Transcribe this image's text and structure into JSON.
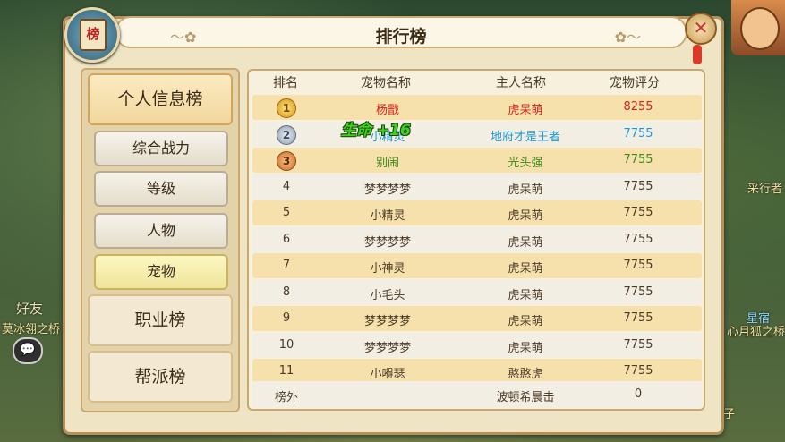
{
  "window": {
    "title": "排行榜",
    "badge_glyph": "榜",
    "close_glyph": "✕"
  },
  "background": {
    "left_name": "好友",
    "left_sub": "莫冰翎之桥",
    "right_name_1": "采行者",
    "right_name_2": "星宿",
    "right_name_3": "心月狐之桥",
    "right_name_4": "子",
    "chat_glyph": "💬"
  },
  "tabs": {
    "personal": "个人信息榜",
    "sub": [
      "综合战力",
      "等级",
      "人物",
      "宠物"
    ],
    "profession": "职业榜",
    "guild": "帮派榜"
  },
  "table": {
    "headers": [
      "排名",
      "宠物名称",
      "主人名称",
      "宠物评分"
    ],
    "rows": [
      {
        "rank": "1",
        "pet": "杨戬",
        "owner": "虎呆萌",
        "score": "8255"
      },
      {
        "rank": "2",
        "pet": "小精灵",
        "owner": "地府才是王者",
        "score": "7755"
      },
      {
        "rank": "3",
        "pet": "别闹",
        "owner": "光头强",
        "score": "7755"
      },
      {
        "rank": "4",
        "pet": "梦梦梦梦",
        "owner": "虎呆萌",
        "score": "7755"
      },
      {
        "rank": "5",
        "pet": "小精灵",
        "owner": "虎呆萌",
        "score": "7755"
      },
      {
        "rank": "6",
        "pet": "梦梦梦梦",
        "owner": "虎呆萌",
        "score": "7755"
      },
      {
        "rank": "7",
        "pet": "小神灵",
        "owner": "虎呆萌",
        "score": "7755"
      },
      {
        "rank": "8",
        "pet": "小毛头",
        "owner": "虎呆萌",
        "score": "7755"
      },
      {
        "rank": "9",
        "pet": "梦梦梦梦",
        "owner": "虎呆萌",
        "score": "7755"
      },
      {
        "rank": "10",
        "pet": "梦梦梦梦",
        "owner": "虎呆萌",
        "score": "7755"
      },
      {
        "rank": "11",
        "pet": "小嘚瑟",
        "owner": "憨憨虎",
        "score": "7755"
      }
    ],
    "footer": {
      "rank": "榜外",
      "pet": "",
      "owner": "波顿希晨击",
      "score": "0"
    }
  },
  "floating_text": "生命 +16",
  "colors": {
    "rank1": "#d3241b",
    "rank2": "#1c9ad6",
    "rank3": "#3e8a17",
    "default": "#4a3a26"
  }
}
